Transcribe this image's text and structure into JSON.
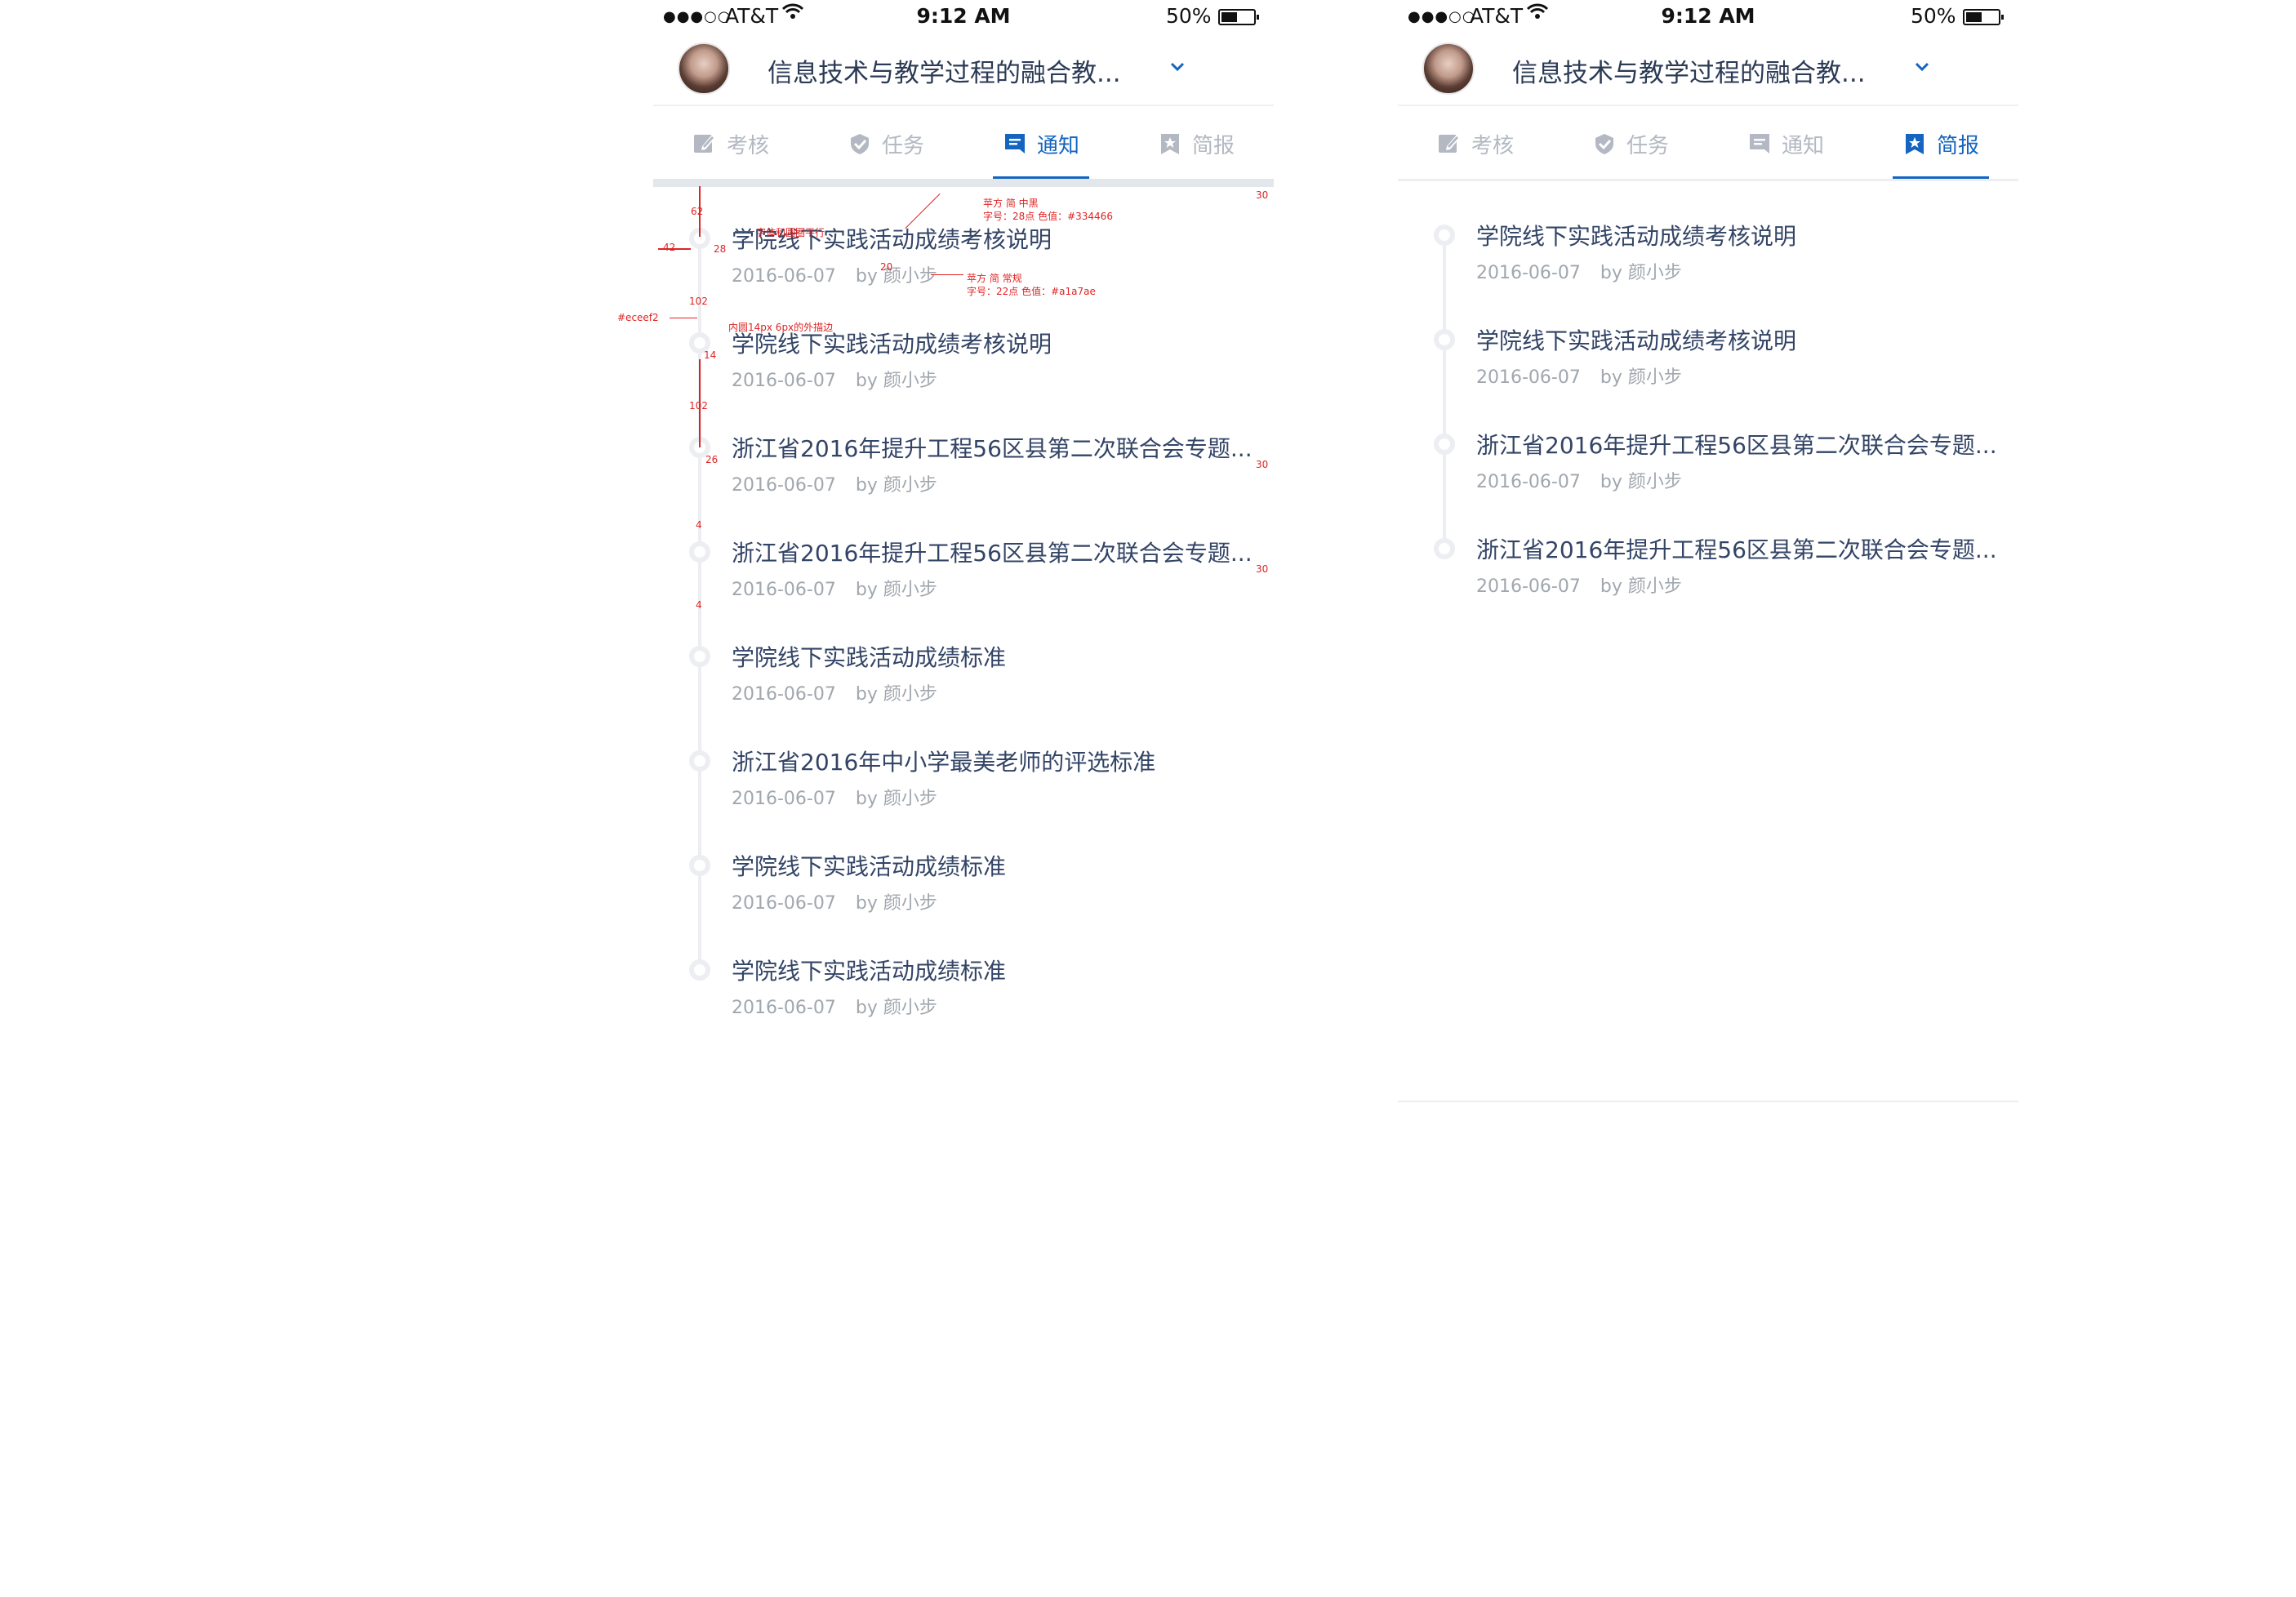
{
  "status": {
    "signal": "●●●○○",
    "carrier": "AT&T",
    "time": "9:12 AM",
    "battery": "50%"
  },
  "header": {
    "course_title": "信息技术与教学过程的融合教..."
  },
  "tabs": [
    {
      "label": "考核",
      "icon": "edit-icon"
    },
    {
      "label": "任务",
      "icon": "shield-check-icon"
    },
    {
      "label": "通知",
      "icon": "message-icon"
    },
    {
      "label": "简报",
      "icon": "star-bookmark-icon"
    }
  ],
  "screens": {
    "left": {
      "active_tab": "通知"
    },
    "right": {
      "active_tab": "简报"
    }
  },
  "notices": [
    {
      "title": "学院线下实践活动成绩考核说明",
      "date": "2016-06-07",
      "author": "by 颜小步"
    },
    {
      "title": "学院线下实践活动成绩考核说明",
      "date": "2016-06-07",
      "author": "by 颜小步"
    },
    {
      "title": "浙江省2016年提升工程56区县第二次联合会专题...",
      "date": "2016-06-07",
      "author": "by 颜小步"
    },
    {
      "title": "浙江省2016年提升工程56区县第二次联合会专题...",
      "date": "2016-06-07",
      "author": "by 颜小步"
    },
    {
      "title": "学院线下实践活动成绩标准",
      "date": "2016-06-07",
      "author": "by 颜小步"
    },
    {
      "title": "浙江省2016年中小学最美老师的评选标准",
      "date": "2016-06-07",
      "author": "by 颜小步"
    },
    {
      "title": "学院线下实践活动成绩标准",
      "date": "2016-06-07",
      "author": "by 颜小步"
    },
    {
      "title": "学院线下实践活动成绩标准",
      "date": "2016-06-07",
      "author": "by 颜小步"
    }
  ],
  "briefs": [
    {
      "title": "学院线下实践活动成绩考核说明",
      "date": "2016-06-07",
      "author": "by 颜小步"
    },
    {
      "title": "学院线下实践活动成绩考核说明",
      "date": "2016-06-07",
      "author": "by 颜小步"
    },
    {
      "title": "浙江省2016年提升工程56区县第二次联合会专题...",
      "date": "2016-06-07",
      "author": "by 颜小步"
    },
    {
      "title": "浙江省2016年提升工程56区县第二次联合会专题...",
      "date": "2016-06-07",
      "author": "by 颜小步"
    }
  ],
  "annotations": {
    "top_gap": "62",
    "left_gap": "42",
    "dot_size": "28",
    "title_meta_gap": "20",
    "item_gap_1": "102",
    "item_gap_2": "102",
    "inner_dot": "14",
    "dot_28b": "26",
    "small_4a": "4",
    "small_4b": "4",
    "right_margin_1": "30",
    "right_margin_2": "30",
    "right_margin_3": "30",
    "align_note": "字体和圆圈平行",
    "title_font_note_1": "苹方 简 中黑",
    "title_font_note_2": "字号：28点   色值：#334466",
    "meta_font_note_1": "苹方 简 常规",
    "meta_font_note_2": "字号：22点   色值：#a1a7ae",
    "rail_color_note": "#eceef2",
    "dot_note": "内圆14px  6px的外描边"
  },
  "colors": {
    "primary": "#1565c0",
    "title": "#334466",
    "meta": "#a1a7ae",
    "rail": "#eceef2",
    "annotation": "#e02424"
  }
}
